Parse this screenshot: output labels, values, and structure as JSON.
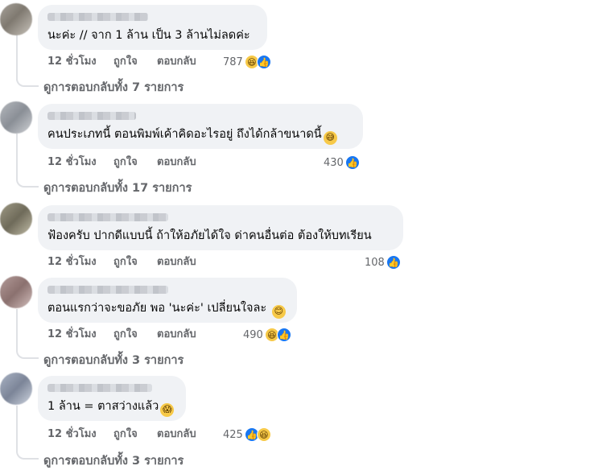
{
  "comments": [
    {
      "text": "นะค่ะ // จาก 1 ล้าน เป็น 3 ล้านไม่ลดค่ะ",
      "time": "12 ชั่วโมง",
      "like": "ถูกใจ",
      "reply": "ตอบกลับ",
      "reaction_count": "787",
      "reactions": [
        "haha-icon",
        "like-icon"
      ],
      "inline_emoji": "",
      "see_replies": "ดูการตอบกลับทั้ง 7 รายการ"
    },
    {
      "text": "คนประเภทนี้ ตอนพิมพ์เค้าคิดอะไรอยู่ ถึงได้กล้าขนาดนี้",
      "time": "12 ชั่วโมง",
      "like": "ถูกใจ",
      "reply": "ตอบกลับ",
      "reaction_count": "430",
      "reactions": [
        "like-icon"
      ],
      "inline_emoji": "grinning-sweat-emoji",
      "see_replies": "ดูการตอบกลับทั้ง 17 รายการ"
    },
    {
      "text": "ฟ้องครับ ปากดีแบบนี้ ถ้าให้อภัยได้ใจ ด่าคนอื่นต่อ ต้องให้บทเรียน",
      "time": "12 ชั่วโมง",
      "like": "ถูกใจ",
      "reply": "ตอบกลับ",
      "reaction_count": "108",
      "reactions": [
        "like-icon"
      ],
      "inline_emoji": "",
      "see_replies": ""
    },
    {
      "text": "ตอนแรกว่าจะขอภัย พอ 'นะค่ะ' เปลี่ยนใจละ",
      "time": "12 ชั่วโมง",
      "like": "ถูกใจ",
      "reply": "ตอบกลับ",
      "reaction_count": "490",
      "reactions": [
        "haha-icon",
        "like-icon"
      ],
      "inline_emoji": "smiling-emoji",
      "see_replies": "ดูการตอบกลับทั้ง 3 รายการ"
    },
    {
      "text": "1 ล้าน = ตาสว่างแล้ว",
      "time": "12 ชั่วโมง",
      "like": "ถูกใจ",
      "reply": "ตอบกลับ",
      "reaction_count": "425",
      "reactions": [
        "like-icon",
        "haha-icon"
      ],
      "inline_emoji": "shocked-emoji",
      "see_replies": "ดูการตอบกลับทั้ง 3 รายการ"
    }
  ],
  "colors": {
    "bubble": "#f0f2f5",
    "meta_text": "#65676b",
    "like_blue": "#1877f2",
    "emoji_yellow": "#f7c948"
  }
}
